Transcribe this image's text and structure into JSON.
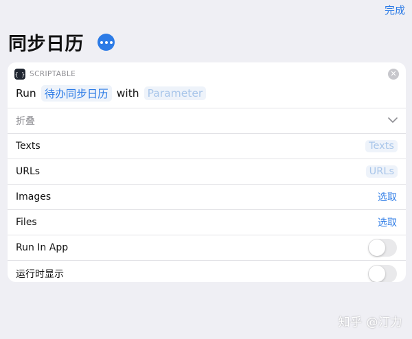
{
  "header": {
    "done_label": "完成",
    "title": "同步日历",
    "more_icon": "ellipsis-icon",
    "accent_color": "#2C7BE6"
  },
  "action": {
    "app_name": "SCRIPTABLE",
    "app_icon": "braces-icon",
    "app_icon_glyph": "{ }",
    "close_icon": "close-icon",
    "close_glyph": "✕",
    "run_word": "Run",
    "script_name": "待办同步日历",
    "with_word": "with",
    "parameter_placeholder": "Parameter"
  },
  "rows": {
    "collapse_label": "折叠",
    "texts_label": "Texts",
    "texts_value": "Texts",
    "urls_label": "URLs",
    "urls_value": "URLs",
    "images_label": "Images",
    "images_action": "选取",
    "files_label": "Files",
    "files_action": "选取",
    "run_in_app_label": "Run In App",
    "run_in_app_on": false,
    "show_when_run_label": "运行时显示",
    "show_when_run_on": false
  },
  "watermark": {
    "text": "知乎 @汀力"
  }
}
